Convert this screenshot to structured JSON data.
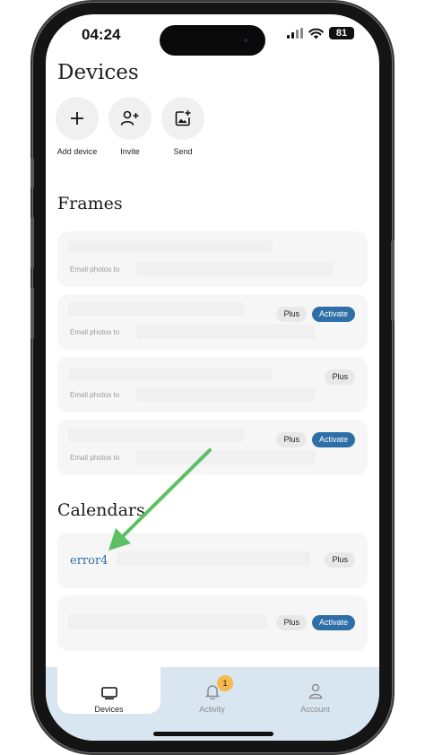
{
  "status_bar": {
    "time": "04:24",
    "battery": "81"
  },
  "page": {
    "title": "Devices"
  },
  "actions": [
    {
      "label": "Add device",
      "icon": "plus-icon"
    },
    {
      "label": "Invite",
      "icon": "add-person-icon"
    },
    {
      "label": "Send",
      "icon": "add-photo-icon"
    }
  ],
  "frames": {
    "title": "Frames",
    "cards": [
      {
        "subtitle": "Email photos to",
        "badges": []
      },
      {
        "subtitle": "Email photos to",
        "badges": [
          "Plus",
          "Activate"
        ]
      },
      {
        "subtitle": "Email photos to",
        "badges": [
          "Plus"
        ]
      },
      {
        "subtitle": "Email photos to",
        "badges": [
          "Plus",
          "Activate"
        ]
      }
    ]
  },
  "calendars": {
    "title": "Calendars",
    "cards": [
      {
        "name": "error4",
        "badges": [
          "Plus"
        ]
      },
      {
        "name": "",
        "badges": [
          "Plus",
          "Activate"
        ]
      }
    ]
  },
  "tab_bar": {
    "tabs": [
      {
        "label": "Devices",
        "icon": "frame-icon",
        "active": true
      },
      {
        "label": "Activity",
        "icon": "bell-icon",
        "active": false,
        "badge": "1"
      },
      {
        "label": "Account",
        "icon": "person-icon",
        "active": false
      }
    ]
  },
  "colors": {
    "accent": "#2f6fa8",
    "tab_bar_bg": "#d8e6f1",
    "badge_yellow": "#f6b94b",
    "arrow_green": "#5cbf63"
  }
}
